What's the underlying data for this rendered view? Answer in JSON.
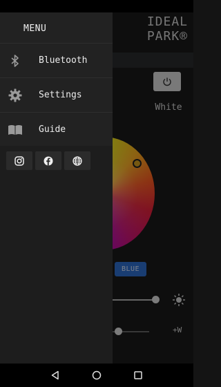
{
  "app": {
    "brand_line1": "IDEAL",
    "brand_line2": "PARK®",
    "mode_label": "White",
    "color_button_label": "BLUE",
    "warm_label": "+W"
  },
  "drawer": {
    "title": "MENU",
    "items": [
      {
        "label": "Bluetooth",
        "icon": "bluetooth-icon"
      },
      {
        "label": "Settings",
        "icon": "gear-icon"
      },
      {
        "label": "Guide",
        "icon": "book-icon"
      }
    ],
    "social": [
      {
        "icon": "instagram-icon"
      },
      {
        "icon": "facebook-icon"
      },
      {
        "icon": "globe-icon"
      }
    ]
  },
  "sliders": {
    "brightness_level": 0.92,
    "white_level": 0.18
  },
  "colors": {
    "accent_blue": "#2f6fcf",
    "drawer_bg": "#222222"
  },
  "nav": {
    "buttons": [
      "back-icon",
      "home-icon",
      "recents-icon"
    ]
  }
}
